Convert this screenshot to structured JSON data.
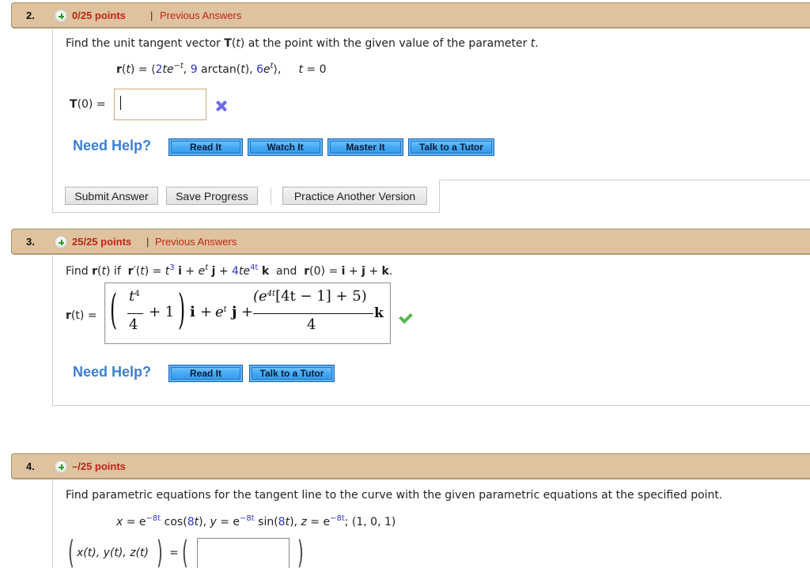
{
  "questions": [
    {
      "number": "2.",
      "points": "0/25 points",
      "separator": "|",
      "previous_answers": "Previous Answers",
      "prompt_parts": [
        "Find the unit tangent vector ",
        "T",
        "(",
        "t",
        ") at the point with the given value of the parameter ",
        "t",
        "."
      ],
      "equation": {
        "lhs_r": "r",
        "lhs_rest_1": "(",
        "lhs_t": "t",
        "lhs_rest_2": ") = ⟨",
        "c1": "2",
        "c1_var": "te",
        "c1_exp": "−t",
        "comma1": ",",
        "c2": "9",
        "c2_rest": " arctan(",
        "c2_t": "t",
        "c2_close": "),",
        "c3": "6",
        "c3_var": "e",
        "c3_exp": "t",
        "close": "⟩,",
        "param_t": "t",
        "param_val": " = 0"
      },
      "answer_label_T": "T",
      "answer_label_rest": "(0) =",
      "answer_value": "",
      "status_icon": "x-icon",
      "need_help": "Need Help?",
      "help_buttons": [
        "Read It",
        "Watch It",
        "Master It",
        "Talk to a Tutor"
      ],
      "actions": {
        "submit": "Submit Answer",
        "save": "Save Progress",
        "practice": "Practice Another Version"
      }
    },
    {
      "number": "3.",
      "points": "25/25 points",
      "separator": "|",
      "previous_answers": "Previous Answers",
      "prompt": {
        "find": "Find ",
        "r": "r",
        "t_open": "(",
        "t": "t",
        "if_text": ") if  ",
        "r2": "r",
        "prime": "′(",
        "t2": "t",
        "eq": ") = ",
        "t3": "t",
        "exp3": "3",
        "i": "i",
        "plus1": " + ",
        "e": "e",
        "expt": "t",
        "j": "j",
        "plus2": " + ",
        "four": "4",
        "te": "te",
        "exp4t": "4t",
        "k": "k",
        "and_text": "  and  ",
        "r3": "r",
        "r0": "(0) = ",
        "i2": "i",
        "plus3": " + ",
        "j2": "j",
        "plus4": " + ",
        "k2": "k",
        "dot": "."
      },
      "answer_label_r": "r",
      "answer_label_rest": "(t) =",
      "answer_math": {
        "lparen": "(",
        "frac1_num": "t",
        "frac1_num_exp": "4",
        "frac1_den": "4",
        "plus_one": "+ 1",
        "rparen": ")",
        "i": "i",
        "plus_a": "+",
        "e": "e",
        "e_exp": "t",
        "j": "j",
        "plus_b": "+",
        "frac2_num": "(e",
        "frac2_num_exp": "4t",
        "frac2_num_rest": "[4t − 1] + 5)",
        "frac2_den": "4",
        "k": "k"
      },
      "status_icon": "check-icon",
      "need_help": "Need Help?",
      "help_buttons": [
        "Read It",
        "Talk to a Tutor"
      ]
    },
    {
      "number": "4.",
      "points": "–/25 points",
      "prompt": "Find parametric equations for the tangent line to the curve with the given parametric equations at the specified point.",
      "equation": {
        "x": "x",
        "eq1": " = e",
        "exp1": "−8t",
        "cos": " cos(",
        "c8a": "8",
        "ta": "t",
        "close1": "), ",
        "y": "y",
        "eq2": " = e",
        "exp2": "−8t",
        "sin": " sin(",
        "c8b": "8",
        "tb": "t",
        "close2": "), ",
        "z": "z",
        "eq3": " = e",
        "exp3": "−8t",
        "point": "; (1, 0, 1)"
      },
      "answer_label": "x(t), y(t), z(t)",
      "answer_eq": "=",
      "answer_value": ""
    }
  ]
}
